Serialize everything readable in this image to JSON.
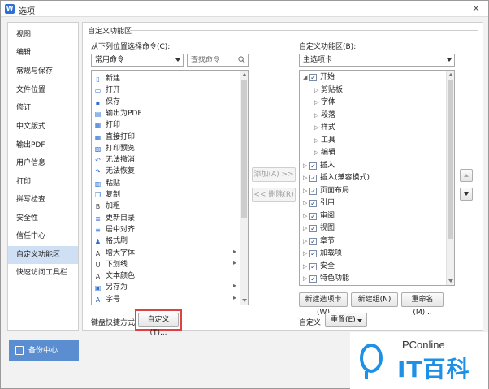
{
  "window": {
    "title": "选项",
    "app_icon": "W",
    "close": "×"
  },
  "sidebar": {
    "items": [
      {
        "label": "视图"
      },
      {
        "label": "编辑"
      },
      {
        "label": "常规与保存"
      },
      {
        "label": "文件位置"
      },
      {
        "label": "修订"
      },
      {
        "label": "中文版式"
      },
      {
        "label": "输出PDF"
      },
      {
        "label": "用户信息"
      },
      {
        "label": "打印"
      },
      {
        "label": "拼写检查"
      },
      {
        "label": "安全性"
      },
      {
        "label": "信任中心"
      },
      {
        "label": "自定义功能区"
      },
      {
        "label": "快速访问工具栏"
      }
    ],
    "active_index": 12,
    "backup_label": "备份中心"
  },
  "main": {
    "group_title": "自定义功能区",
    "left": {
      "label": "从下列位置选择命令(C):",
      "combo_value": "常用命令",
      "search_placeholder": "查找命令",
      "commands": [
        {
          "label": "新建",
          "icon": "doc-icon"
        },
        {
          "label": "打开",
          "icon": "folder-icon"
        },
        {
          "label": "保存",
          "icon": "save-icon"
        },
        {
          "label": "输出为PDF",
          "icon": "pdf-icon"
        },
        {
          "label": "打印",
          "icon": "printer-icon"
        },
        {
          "label": "直接打印",
          "icon": "printer-icon"
        },
        {
          "label": "打印预览",
          "icon": "preview-icon"
        },
        {
          "label": "无法撤消",
          "icon": "undo-icon"
        },
        {
          "label": "无法恢复",
          "icon": "redo-icon"
        },
        {
          "label": "粘贴",
          "icon": "paste-icon"
        },
        {
          "label": "复制",
          "icon": "copy-icon"
        },
        {
          "label": "加粗",
          "icon": "bold-icon"
        },
        {
          "label": "更新目录",
          "icon": "toc-icon"
        },
        {
          "label": "居中对齐",
          "icon": "align-center-icon"
        },
        {
          "label": "格式刷",
          "icon": "format-painter-icon"
        },
        {
          "label": "增大字体",
          "icon": "font-grow-icon"
        },
        {
          "label": "下划线",
          "icon": "underline-icon"
        },
        {
          "label": "文本颜色",
          "icon": "text-color-icon"
        },
        {
          "label": "另存为",
          "icon": "save-as-icon"
        },
        {
          "label": "字号",
          "icon": "font-size-icon"
        }
      ],
      "shortcut_label": "键盘快捷方式:",
      "shortcut_button": "自定义(T)..."
    },
    "middle": {
      "add_label": "添加(A) >>",
      "remove_label": "<< 删除(R)"
    },
    "right": {
      "label": "自定义功能区(B):",
      "combo_value": "主选项卡",
      "tree": [
        {
          "label": "开始",
          "level": 0,
          "expanded": true,
          "checked": true
        },
        {
          "label": "剪贴板",
          "level": 1
        },
        {
          "label": "字体",
          "level": 1
        },
        {
          "label": "段落",
          "level": 1
        },
        {
          "label": "样式",
          "level": 1
        },
        {
          "label": "工具",
          "level": 1
        },
        {
          "label": "编辑",
          "level": 1
        },
        {
          "label": "插入",
          "level": 0,
          "checked": true
        },
        {
          "label": "插入(兼容模式)",
          "level": 0,
          "checked": true
        },
        {
          "label": "页面布局",
          "level": 0,
          "checked": true
        },
        {
          "label": "引用",
          "level": 0,
          "checked": true
        },
        {
          "label": "审阅",
          "level": 0,
          "checked": true
        },
        {
          "label": "视图",
          "level": 0,
          "checked": true
        },
        {
          "label": "章节",
          "level": 0,
          "checked": true
        },
        {
          "label": "加载项",
          "level": 0,
          "checked": true
        },
        {
          "label": "安全",
          "level": 0,
          "checked": true
        },
        {
          "label": "特色功能",
          "level": 0,
          "checked": true
        }
      ],
      "new_tab": "新建选项卡(W)",
      "new_group": "新建组(N)",
      "rename": "重命名(M)...",
      "custom_label": "自定义:",
      "reset_label": "重置(E)"
    }
  },
  "watermark": {
    "top": "PConline",
    "bottom": "IT百科"
  },
  "colors": {
    "accent": "#2d6fd3",
    "active_bg": "#cfe0f5",
    "highlight": "#e04040",
    "backup_bg": "#5a8ed0"
  }
}
